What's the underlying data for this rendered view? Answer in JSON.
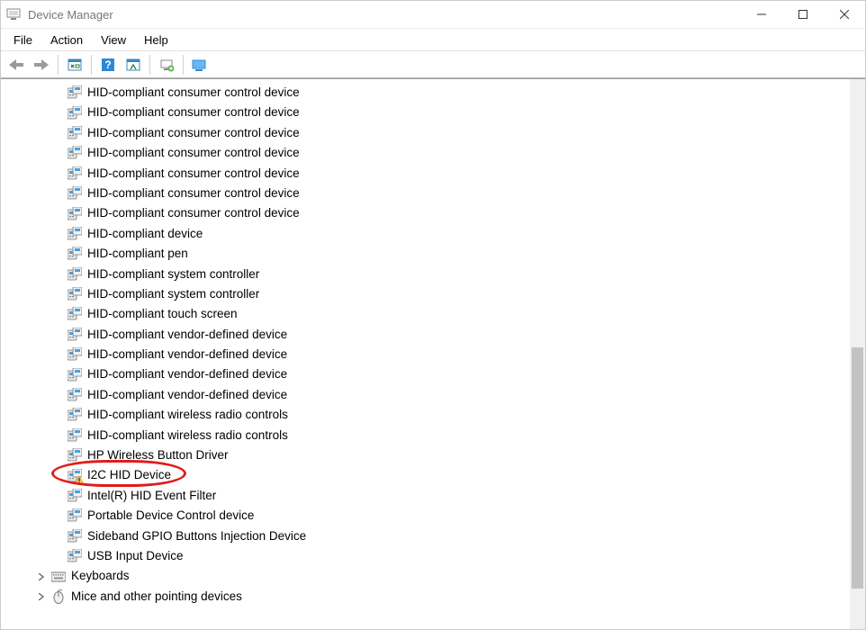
{
  "window": {
    "title": "Device Manager"
  },
  "menus": {
    "file": "File",
    "action": "Action",
    "view": "View",
    "help": "Help"
  },
  "devices": [
    {
      "label": "HID-compliant consumer control device",
      "warn": false
    },
    {
      "label": "HID-compliant consumer control device",
      "warn": false
    },
    {
      "label": "HID-compliant consumer control device",
      "warn": false
    },
    {
      "label": "HID-compliant consumer control device",
      "warn": false
    },
    {
      "label": "HID-compliant consumer control device",
      "warn": false
    },
    {
      "label": "HID-compliant consumer control device",
      "warn": false
    },
    {
      "label": "HID-compliant consumer control device",
      "warn": false
    },
    {
      "label": "HID-compliant device",
      "warn": false
    },
    {
      "label": "HID-compliant pen",
      "warn": false
    },
    {
      "label": "HID-compliant system controller",
      "warn": false
    },
    {
      "label": "HID-compliant system controller",
      "warn": false
    },
    {
      "label": "HID-compliant touch screen",
      "warn": false
    },
    {
      "label": "HID-compliant vendor-defined device",
      "warn": false
    },
    {
      "label": "HID-compliant vendor-defined device",
      "warn": false
    },
    {
      "label": "HID-compliant vendor-defined device",
      "warn": false
    },
    {
      "label": "HID-compliant vendor-defined device",
      "warn": false
    },
    {
      "label": "HID-compliant wireless radio controls",
      "warn": false
    },
    {
      "label": "HID-compliant wireless radio controls",
      "warn": false
    },
    {
      "label": "HP Wireless Button Driver",
      "warn": false
    },
    {
      "label": "I2C HID Device",
      "warn": true
    },
    {
      "label": "Intel(R) HID Event Filter",
      "warn": false
    },
    {
      "label": "Portable Device Control device",
      "warn": false
    },
    {
      "label": "Sideband GPIO Buttons Injection Device",
      "warn": false
    },
    {
      "label": "USB Input Device",
      "warn": false
    }
  ],
  "categories": [
    {
      "label": "Keyboards",
      "icon": "keyboard"
    },
    {
      "label": "Mice and other pointing devices",
      "icon": "mouse"
    }
  ],
  "annotation": {
    "deviceIndex": 19
  }
}
